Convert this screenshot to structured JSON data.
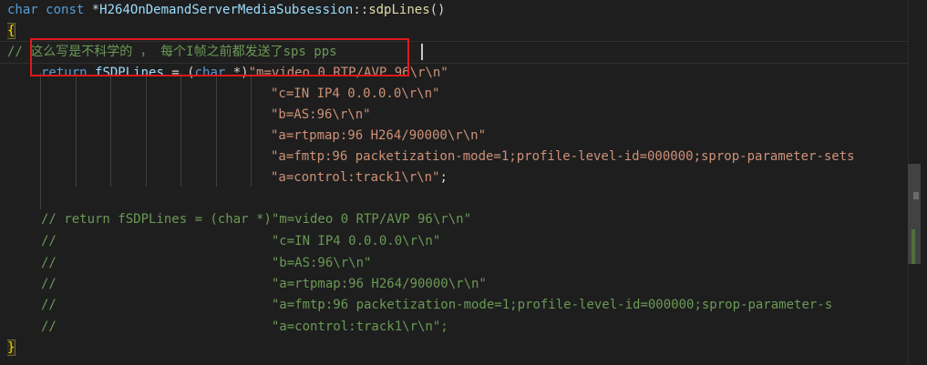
{
  "editor": {
    "line1": {
      "kw_char": "char",
      "kw_const": "const",
      "star": " *",
      "cls": "H264OnDemandServerMediaSubsession",
      "sep": "::",
      "method": "sdpLines",
      "parens": "()"
    },
    "line2_brace": "{",
    "line3_comment": "// 这么写是不科学的 ， 每个I帧之前都发送了sps pps",
    "line4": {
      "kw_return": "return",
      "var": "fSDPLines",
      "eq": " = (",
      "kw_char": "char",
      "cast_end": " *)",
      "str": "\"m=video 0 RTP/AVP 96\\r\\n\""
    },
    "strings": [
      "\"c=IN IP4 0.0.0.0\\r\\n\"",
      "\"b=AS:96\\r\\n\"",
      "\"a=rtpmap:96 H264/90000\\r\\n\"",
      "\"a=fmtp:96 packetization-mode=1;profile-level-id=000000;sprop-parameter-sets",
      "\"a=control:track1\\r\\n\""
    ],
    "semicolon": ";",
    "comments": [
      "// return fSDPLines = (char *)\"m=video 0 RTP/AVP 96\\r\\n\"",
      "//                            \"c=IN IP4 0.0.0.0\\r\\n\"",
      "//                            \"b=AS:96\\r\\n\"",
      "//                            \"a=rtpmap:96 H264/90000\\r\\n\"",
      "//                            \"a=fmtp:96 packetization-mode=1;profile-level-id=000000;sprop-parameter-s",
      "//                            \"a=control:track1\\r\\n\";"
    ],
    "closing_brace": "}"
  }
}
